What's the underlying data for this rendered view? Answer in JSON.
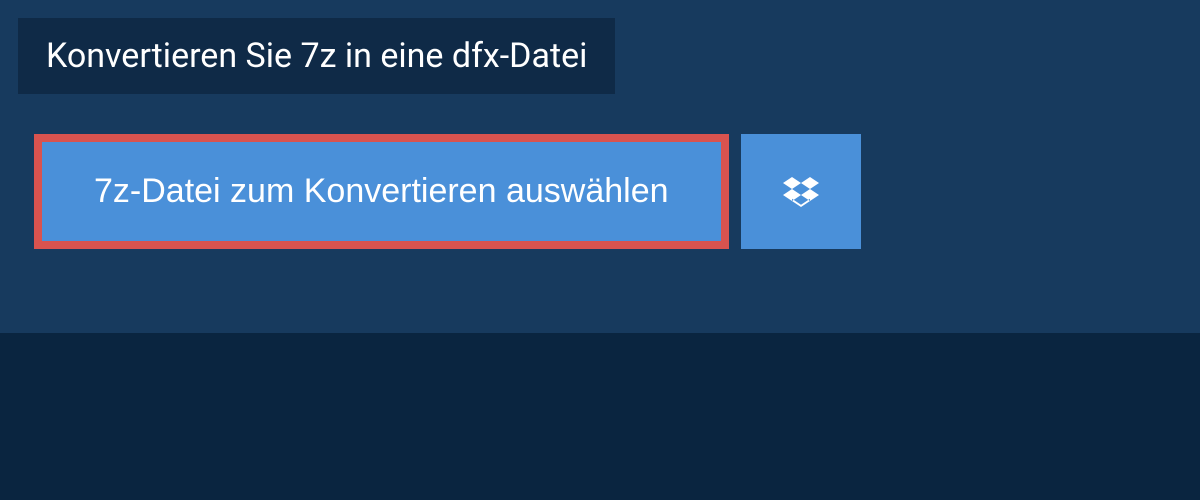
{
  "header": {
    "title": "Konvertieren Sie 7z in eine dfx-Datei"
  },
  "actions": {
    "select_file_label": "7z-Datei zum Konvertieren auswählen"
  },
  "colors": {
    "background": "#0a2540",
    "panel": "#173a5e",
    "title_bg": "#0f2a47",
    "button": "#4a90d9",
    "highlight_border": "#d9534f",
    "text": "#ffffff"
  }
}
